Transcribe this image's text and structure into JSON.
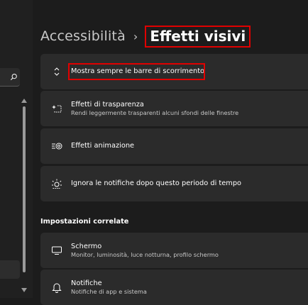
{
  "breadcrumb": {
    "parent": "Accessibilità",
    "separator": "›",
    "current": "Effetti visivi"
  },
  "cards": {
    "scrollbars": {
      "title": "Mostra sempre le barre di scorrimento",
      "icon": "scroll-arrows-icon"
    },
    "transparency": {
      "title": "Effetti di trasparenza",
      "subtitle": "Rendi leggermente trasparenti alcuni sfondi delle finestre",
      "icon": "transparency-sparkle-icon"
    },
    "animation": {
      "title": "Effetti animazione",
      "icon": "animation-icon"
    },
    "notifications": {
      "title": "Ignora le notifiche dopo questo periodo di tempo",
      "icon": "brightness-icon"
    }
  },
  "related": {
    "section_title": "Impostazioni correlate",
    "screen": {
      "title": "Schermo",
      "subtitle": "Monitor, luminosità, luce notturna, profilo schermo",
      "icon": "monitor-icon"
    },
    "notifiche": {
      "title": "Notifiche",
      "subtitle": "Notifiche di app e sistema",
      "icon": "bell-icon"
    }
  },
  "sidebar": {
    "search_icon": "search-icon"
  },
  "colors": {
    "background": "#1c1c1c",
    "card": "#2b2b2b",
    "highlight_border": "#e00000"
  }
}
